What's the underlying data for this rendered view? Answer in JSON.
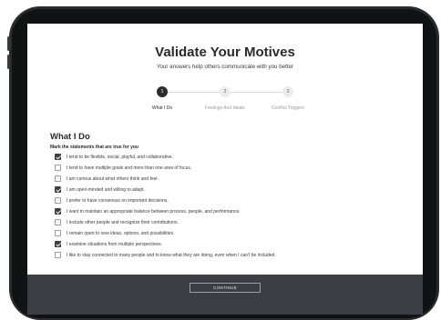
{
  "header": {
    "title": "Validate Your Motives",
    "subtitle": "Your answers help others communicate with you better"
  },
  "steps": [
    {
      "number": "1",
      "label": "What I Do",
      "active": true
    },
    {
      "number": "2",
      "label": "Feelings And Ideals",
      "active": false
    },
    {
      "number": "3",
      "label": "Conflict Triggers",
      "active": false
    }
  ],
  "section": {
    "title": "What I Do",
    "instruction": "Mark the statements that are true for you"
  },
  "statements": [
    {
      "text": "I tend to be flexible, social, playful, and collaborative.",
      "checked": true
    },
    {
      "text": "I tend to have multiple goals and more than one area of focus.",
      "checked": false
    },
    {
      "text": "I am curious about what others think and feel.",
      "checked": false
    },
    {
      "text": "I am open-minded and willing to adapt.",
      "checked": true
    },
    {
      "text": "I prefer to have consensus on important decisions.",
      "checked": false
    },
    {
      "text": "I want to maintain an appropriate balance between process, people, and performance.",
      "checked": true
    },
    {
      "text": "I include other people and recognize their contributions.",
      "checked": false
    },
    {
      "text": "I remain open to new ideas, options, and possibilities.",
      "checked": false
    },
    {
      "text": "I examine situations from multiple perspectives.",
      "checked": true
    },
    {
      "text": "I like to stay connected to many people and to know what they are doing, even when I can't be included.",
      "checked": false
    }
  ],
  "footer": {
    "continue_label": "CONTINUE"
  },
  "colors": {
    "accent": "#2c2c2c",
    "footer_bg": "#3b3f44",
    "device_frame": "#2a2b2e"
  }
}
